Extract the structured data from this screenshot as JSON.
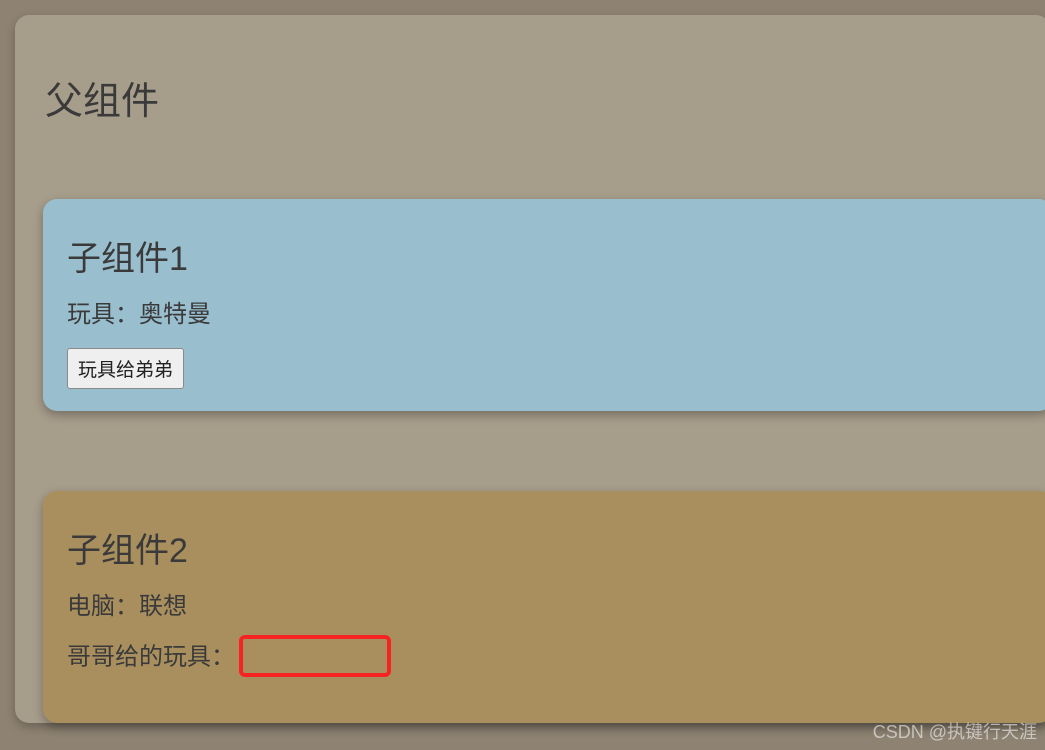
{
  "parent": {
    "title": "父组件"
  },
  "child1": {
    "title": "子组件1",
    "toy_label": "玩具：",
    "toy_value": "奥特曼",
    "button_label": "玩具给弟弟"
  },
  "child2": {
    "title": "子组件2",
    "computer_label": "电脑：",
    "computer_value": "联想",
    "brother_toy_label": "哥哥给的玩具：",
    "brother_toy_value": ""
  },
  "watermark": "CSDN @执键行天涯"
}
